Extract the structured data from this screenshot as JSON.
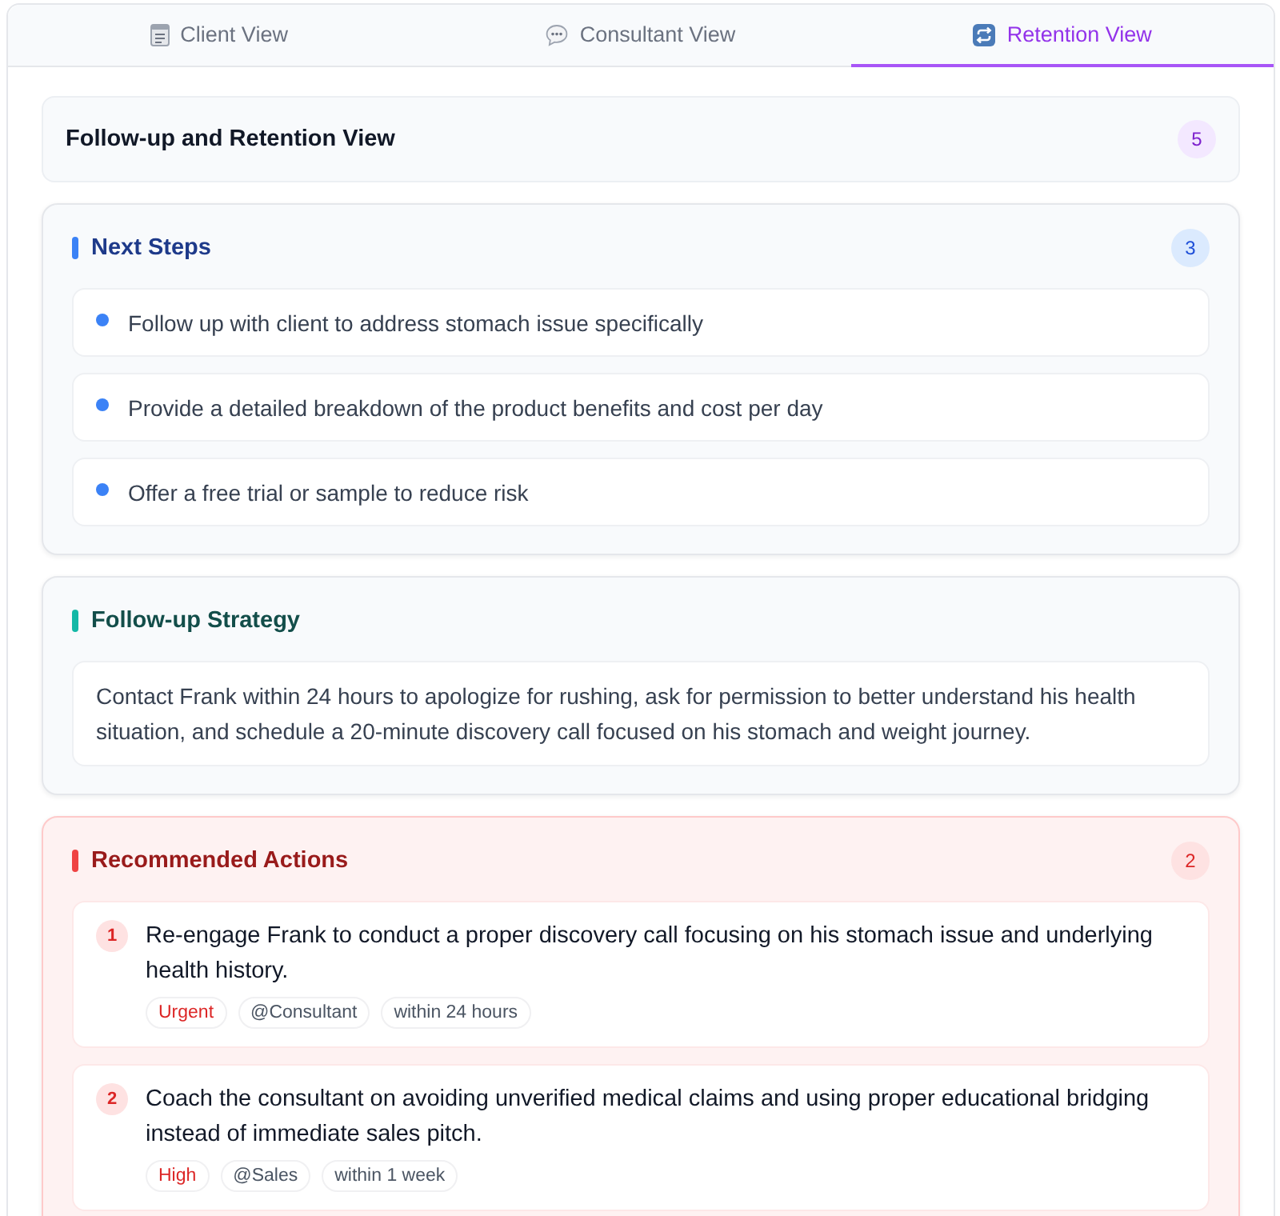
{
  "tabs": [
    {
      "label": "Client View",
      "selected": false
    },
    {
      "label": "Consultant View",
      "selected": false
    },
    {
      "label": "Retention View",
      "selected": true
    }
  ],
  "header": {
    "title": "Follow-up and Retention View",
    "count": "5"
  },
  "sections": [
    {
      "kind": "steps",
      "title": "Next Steps",
      "count": "3",
      "items": [
        "Follow up with client to address stomach issue specifically",
        "Provide a detailed breakdown of the product benefits and cost per day",
        "Offer a free trial or sample to reduce risk"
      ]
    },
    {
      "kind": "strategy",
      "title": "Follow-up Strategy",
      "text": "Contact Frank within 24 hours to apologize for rushing, ask for permission to better understand his health situation, and schedule a 20-minute discovery call focused on his stomach and weight journey."
    },
    {
      "kind": "actions",
      "title": "Recommended Actions",
      "count": "2",
      "items": [
        {
          "number": "1",
          "text": "Re-engage Frank to conduct a proper discovery call focusing on his stomach issue and underlying health history.",
          "tags": [
            {
              "kind": "priority",
              "label": "Urgent"
            },
            {
              "kind": "owner",
              "label": "@Consultant"
            },
            {
              "kind": "timing",
              "label": "within 24 hours"
            }
          ]
        },
        {
          "number": "2",
          "text": "Coach the consultant on avoiding unverified medical claims and using proper educational bridging instead of immediate sales pitch.",
          "tags": [
            {
              "kind": "priority",
              "label": "High"
            },
            {
              "kind": "owner",
              "label": "@Sales"
            },
            {
              "kind": "timing",
              "label": "within 1 week"
            }
          ]
        }
      ]
    }
  ]
}
